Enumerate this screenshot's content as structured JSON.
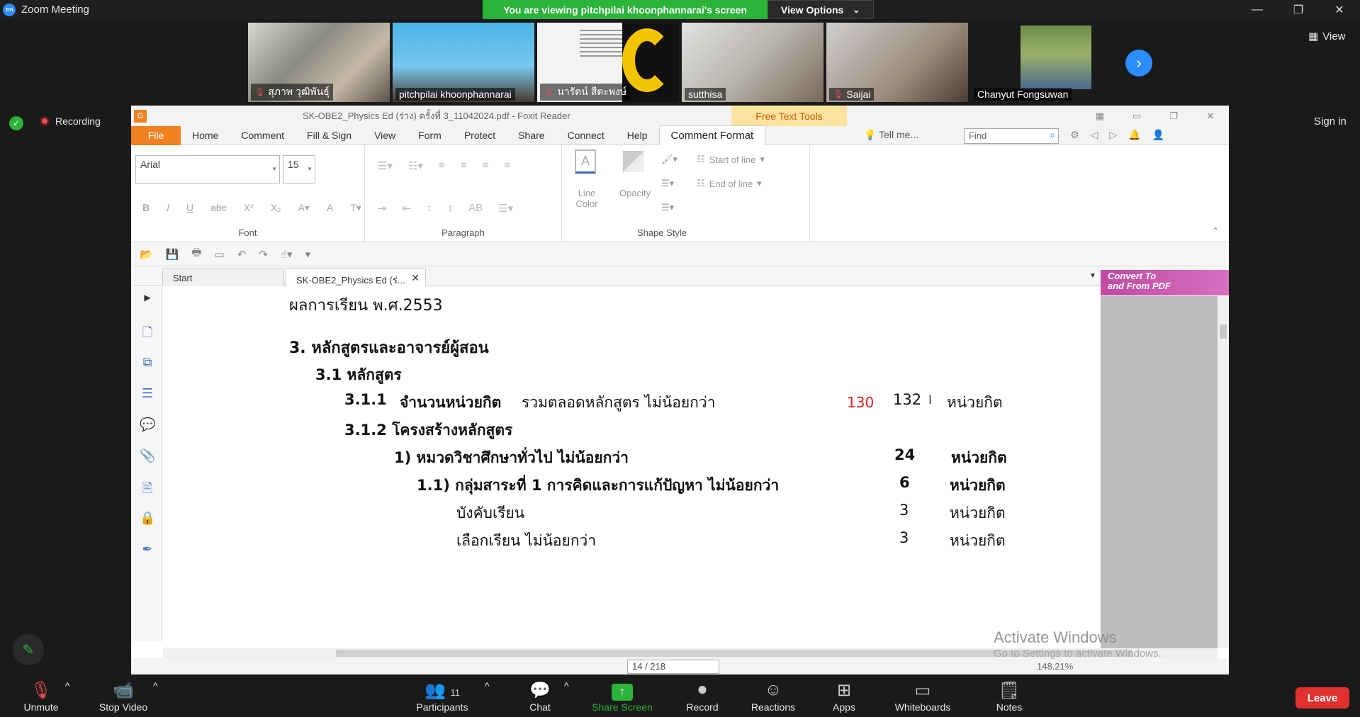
{
  "zoom": {
    "app_title": "Zoom Meeting",
    "logo_text": "zm",
    "share_banner": "You are viewing pitchpilai khoonphannarai's screen",
    "view_options": "View Options",
    "view_label": "View",
    "recording_label": "Recording",
    "sign_in": "Sign in",
    "participants": [
      {
        "name": "สุภาพ วุฒิพันธุ์",
        "muted": true
      },
      {
        "name": "pitchpilai khoonphannarai",
        "muted": false
      },
      {
        "name": "นารัตน์ สีตะพงษ์",
        "muted": true
      },
      {
        "name": "sutthisa",
        "muted": false
      },
      {
        "name": "Saijai",
        "muted": true
      },
      {
        "name": "Chanyut Fongsuwan",
        "muted": false
      }
    ],
    "toolbar": {
      "unmute": "Unmute",
      "stop_video": "Stop Video",
      "participants": "Participants",
      "participant_count": "11",
      "chat": "Chat",
      "share_screen": "Share Screen",
      "record": "Record",
      "reactions": "Reactions",
      "apps": "Apps",
      "whiteboards": "Whiteboards",
      "notes": "Notes",
      "leave": "Leave"
    }
  },
  "foxit": {
    "window_title": "SK-OBE2_Physics Ed (ร่าง) ครั้งที่ 3_11042024.pdf - Foxit Reader",
    "free_text_tools": "Free Text Tools",
    "menu": [
      "File",
      "Home",
      "Comment",
      "Fill & Sign",
      "View",
      "Form",
      "Protect",
      "Share",
      "Connect",
      "Help",
      "Comment Format"
    ],
    "tell_me": "Tell me...",
    "find_placeholder": "Find",
    "ribbon": {
      "font_name": "Arial",
      "font_size": "15",
      "font_group": "Font",
      "paragraph_group": "Paragraph",
      "shape_group": "Shape Style",
      "line_color": "Line Color",
      "opacity": "Opacity",
      "start_of_line": "Start of line",
      "end_of_line": "End of line"
    },
    "tabs": {
      "start": "Start",
      "doc": "SK-OBE2_Physics Ed (ร่..."
    },
    "convert_line1": "Convert To",
    "convert_line2": "and From PDF",
    "page_indicator": "14 / 218",
    "zoom_level": "148.21%",
    "activate_title": "Activate Windows",
    "activate_sub": "Go to Settings to activate Windows."
  },
  "pdf": {
    "l1": "ผลการเรียน  พ.ศ.2553",
    "l2": "3.  หลักสูตรและอาจารย์ผู้สอน",
    "l3": "3.1 หลักสูตร",
    "l4_num": "3.1.1",
    "l4_title": "จำนวนหน่วยกิต",
    "l4_rest": "รวมตลอดหลักสูตร ไม่น้อยกว่า",
    "l4_red": "130",
    "l4_val": "132",
    "l4_unit": "หน่วยกิต",
    "l5": "3.1.2  โครงสร้างหลักสูตร",
    "l6": "1) หมวดวิชาศึกษาทั่วไป ไม่น้อยกว่า",
    "l6_val": "24",
    "l6_unit": "หน่วยกิต",
    "l7": "1.1)  กลุ่มสาระที่ 1 การคิดและการแก้ปัญหา ไม่น้อยกว่า",
    "l7_val": "6",
    "l7_unit": "หน่วยกิต",
    "l8": "บังคับเรียน",
    "l8_val": "3",
    "l8_unit": "หน่วยกิต",
    "l9": "เลือกเรียน  ไม่น้อยกว่า",
    "l9_val": "3",
    "l9_unit": "หน่วยกิต"
  }
}
